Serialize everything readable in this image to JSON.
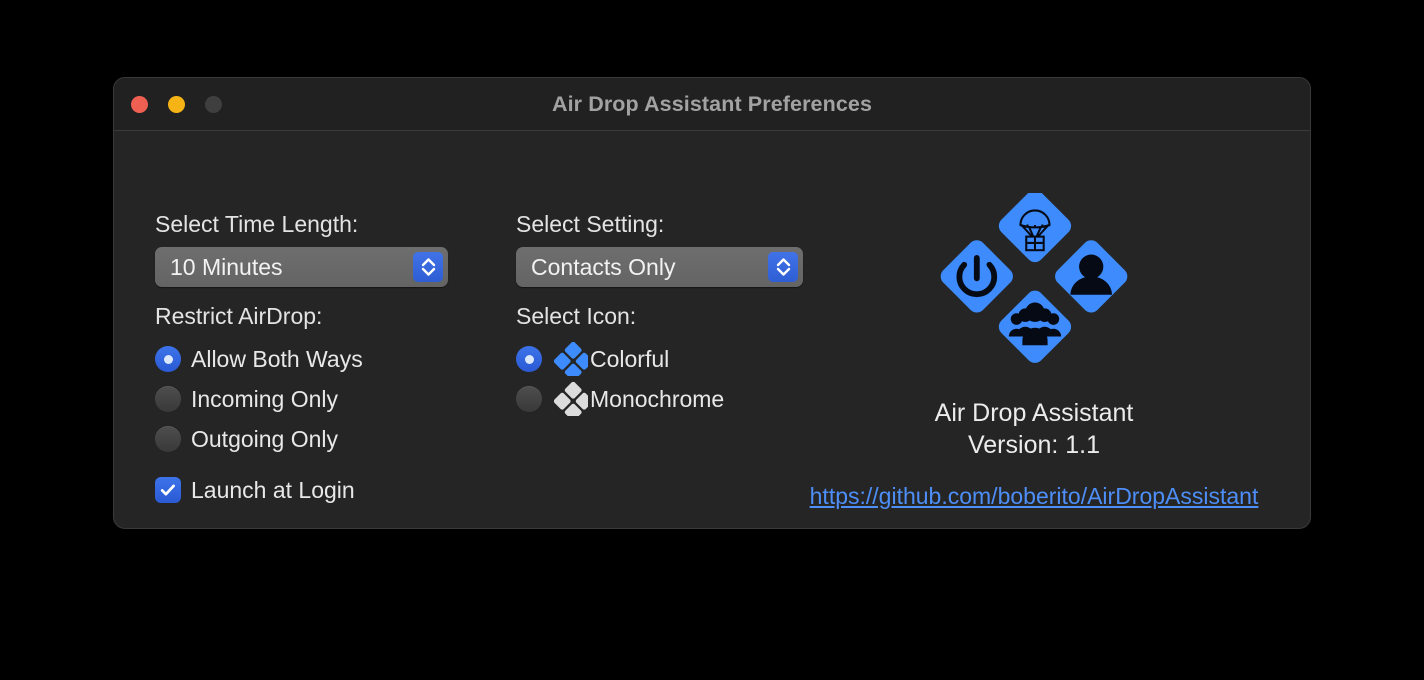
{
  "window": {
    "title": "Air Drop Assistant Preferences",
    "traffic_lights": [
      {
        "name": "close",
        "color": "#ef5f52"
      },
      {
        "name": "minimize",
        "color": "#f5b316"
      },
      {
        "name": "zoom",
        "color": "#3f3f3f"
      }
    ],
    "background": "#252525",
    "titlebar_background": "#212121"
  },
  "accent_color": "#2f5ed4",
  "time_length": {
    "label": "Select Time Length:",
    "value": "10 Minutes",
    "stepper_icon": "chevron-up-down-icon"
  },
  "setting": {
    "label": "Select Setting:",
    "value": "Contacts Only",
    "stepper_icon": "chevron-up-down-icon"
  },
  "restrict_airdrop": {
    "label": "Restrict AirDrop:",
    "options": [
      {
        "label": "Allow Both Ways",
        "selected": true
      },
      {
        "label": "Incoming Only",
        "selected": false
      },
      {
        "label": "Outgoing Only",
        "selected": false
      }
    ]
  },
  "launch_at_login": {
    "label": "Launch at Login",
    "checked": true
  },
  "select_icon": {
    "label": "Select Icon:",
    "options": [
      {
        "label": "Colorful",
        "selected": true,
        "swatch": "#3d8bfd",
        "icon": "diamond-cluster-icon"
      },
      {
        "label": "Monochrome",
        "selected": false,
        "swatch": "#dcdcdc",
        "icon": "diamond-cluster-icon"
      }
    ]
  },
  "about": {
    "logo_icon": "airdrop-assistant-logo-icon",
    "logo_parts": [
      "parachute-gift-icon",
      "power-icon",
      "person-icon",
      "group-icon"
    ],
    "app_name": "Air Drop Assistant",
    "version": "Version: 1.1",
    "link": "https://github.com/boberito/AirDropAssistant",
    "link_color": "#4d8ef7"
  }
}
